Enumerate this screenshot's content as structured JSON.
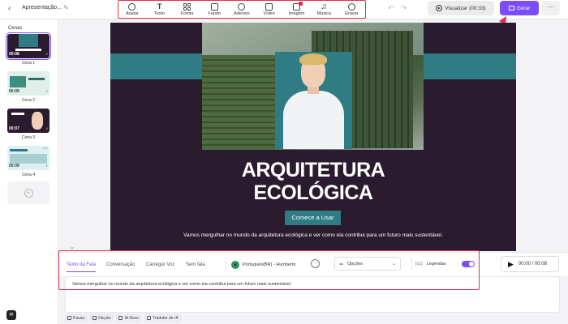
{
  "header": {
    "project_title": "Apresentação...",
    "tools": [
      {
        "label": "Avatar",
        "icon": "avatar-icon"
      },
      {
        "label": "Texto",
        "icon": "text-icon"
      },
      {
        "label": "Forma",
        "icon": "shape-icon"
      },
      {
        "label": "Fundo",
        "icon": "background-icon"
      },
      {
        "label": "Adesivo",
        "icon": "sticker-icon"
      },
      {
        "label": "Vídeo",
        "icon": "video-icon"
      },
      {
        "label": "Imagem",
        "icon": "image-icon"
      },
      {
        "label": "Música",
        "icon": "music-icon"
      },
      {
        "label": "Gravar",
        "icon": "record-icon"
      }
    ],
    "preview_label": "Visualizar (00:33)",
    "generate_label": "Gerar",
    "more_label": "···"
  },
  "sidebar": {
    "title": "Cenas",
    "scenes": [
      {
        "label": "Cena 1",
        "duration": "00:08"
      },
      {
        "label": "Cena 2",
        "duration": "00:09"
      },
      {
        "label": "Cena 3",
        "duration": "00:07"
      },
      {
        "label": "Cena 4",
        "duration": "00:09"
      }
    ]
  },
  "slide": {
    "heading_line1": "ARQUITETURA",
    "heading_line2": "ECOLÓGICA",
    "cta": "Comece a Usar",
    "subtitle": "Vamos mergulhar no mundo da arquitetura ecológica e ver como ela contribui para um futuro mais sustentável."
  },
  "panel": {
    "tabs": [
      "Texto da Fala",
      "Conversação",
      "Carregar Voz",
      "Sem fala"
    ],
    "voice": "Português(BR) - Humberto",
    "options_label": "Opções",
    "captions_label": "Legendas",
    "captions_on": true,
    "time": "00:00 / 00:08",
    "script_text": "Vamos mergulhar no mundo da arquitetura ecológica e ver como ela contribui para um futuro mais sustentável.",
    "bottom_tools": [
      "Pausa",
      "Dicção",
      "IA Novo",
      "Tradutor de IA"
    ]
  },
  "colors": {
    "accent": "#7c4dff",
    "highlight": "#e0334a",
    "slide_bg": "#2b1b2e",
    "teal": "#2f7c85"
  }
}
